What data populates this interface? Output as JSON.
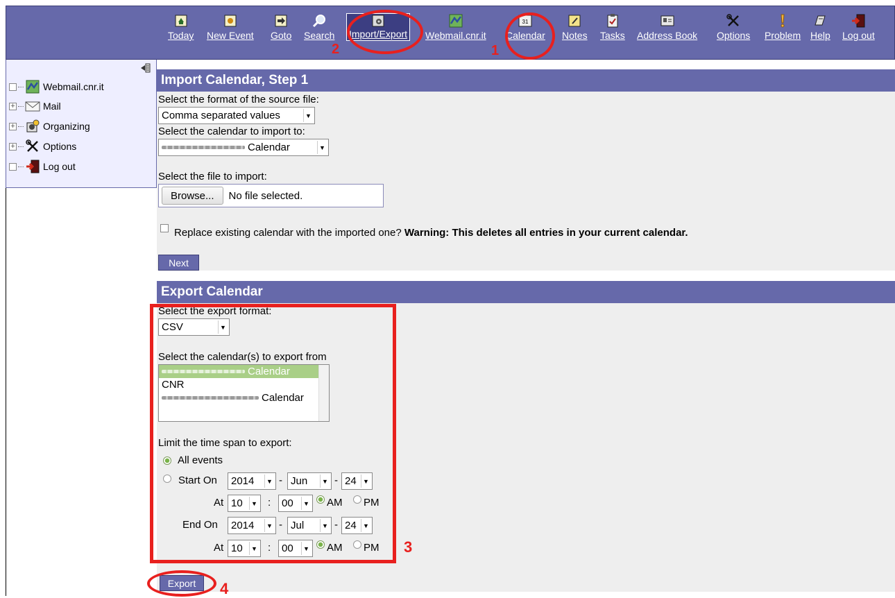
{
  "toolbar": {
    "items": [
      {
        "label": "Today",
        "icon": "today-icon"
      },
      {
        "label": "New Event",
        "icon": "new-event-icon"
      },
      {
        "label": "Goto",
        "icon": "goto-icon"
      },
      {
        "label": "Search",
        "icon": "search-icon"
      },
      {
        "label": "Import/Export",
        "icon": "import-export-icon"
      },
      {
        "label": "Webmail.cnr.it",
        "icon": "webmail-icon"
      },
      {
        "label": "Calendar",
        "icon": "calendar-icon"
      },
      {
        "label": "Notes",
        "icon": "notes-icon"
      },
      {
        "label": "Tasks",
        "icon": "tasks-icon"
      },
      {
        "label": "Address Book",
        "icon": "address-book-icon"
      },
      {
        "label": "Options",
        "icon": "options-icon"
      },
      {
        "label": "Problem",
        "icon": "problem-icon"
      },
      {
        "label": "Help",
        "icon": "help-icon"
      },
      {
        "label": "Log out",
        "icon": "logout-icon"
      }
    ],
    "calendar_icon_text": "31"
  },
  "sidebar": {
    "items": [
      {
        "label": "Webmail.cnr.it",
        "toggle": ""
      },
      {
        "label": "Mail",
        "toggle": "+"
      },
      {
        "label": "Organizing",
        "toggle": "+"
      },
      {
        "label": "Options",
        "toggle": "+"
      },
      {
        "label": "Log out",
        "toggle": ""
      }
    ]
  },
  "import": {
    "title": "Import Calendar, Step 1",
    "format_label": "Select the format of the source file:",
    "format_value": "Comma separated values",
    "calendar_label": "Select the calendar to import to:",
    "calendar_value": "Calendar",
    "file_label": "Select the file to import:",
    "browse_label": "Browse...",
    "file_status": "No file selected.",
    "replace_text": "Replace existing calendar with the imported one?",
    "replace_warning": "Warning: This deletes all entries in your current calendar.",
    "next_label": "Next"
  },
  "export": {
    "title": "Export Calendar",
    "format_label": "Select the export format:",
    "format_value": "CSV",
    "calendars_label": "Select the calendar(s) to export from",
    "calendars": [
      "Calendar",
      "CNR",
      "Calendar"
    ],
    "timespan_label": "Limit the time span to export:",
    "all_events_label": "All events",
    "start_on_label": "Start On",
    "end_on_label": "End On",
    "at_label": "At",
    "dash": "-",
    "colon": ":",
    "am_label": "AM",
    "pm_label": "PM",
    "start": {
      "year": "2014",
      "month": "Jun",
      "day": "24",
      "hour": "10",
      "minute": "00"
    },
    "end": {
      "year": "2014",
      "month": "Jul",
      "day": "24",
      "hour": "10",
      "minute": "00"
    },
    "export_label": "Export"
  },
  "annotations": {
    "n1": "1",
    "n2": "2",
    "n3": "3",
    "n4": "4",
    "color": "#e8201e"
  }
}
